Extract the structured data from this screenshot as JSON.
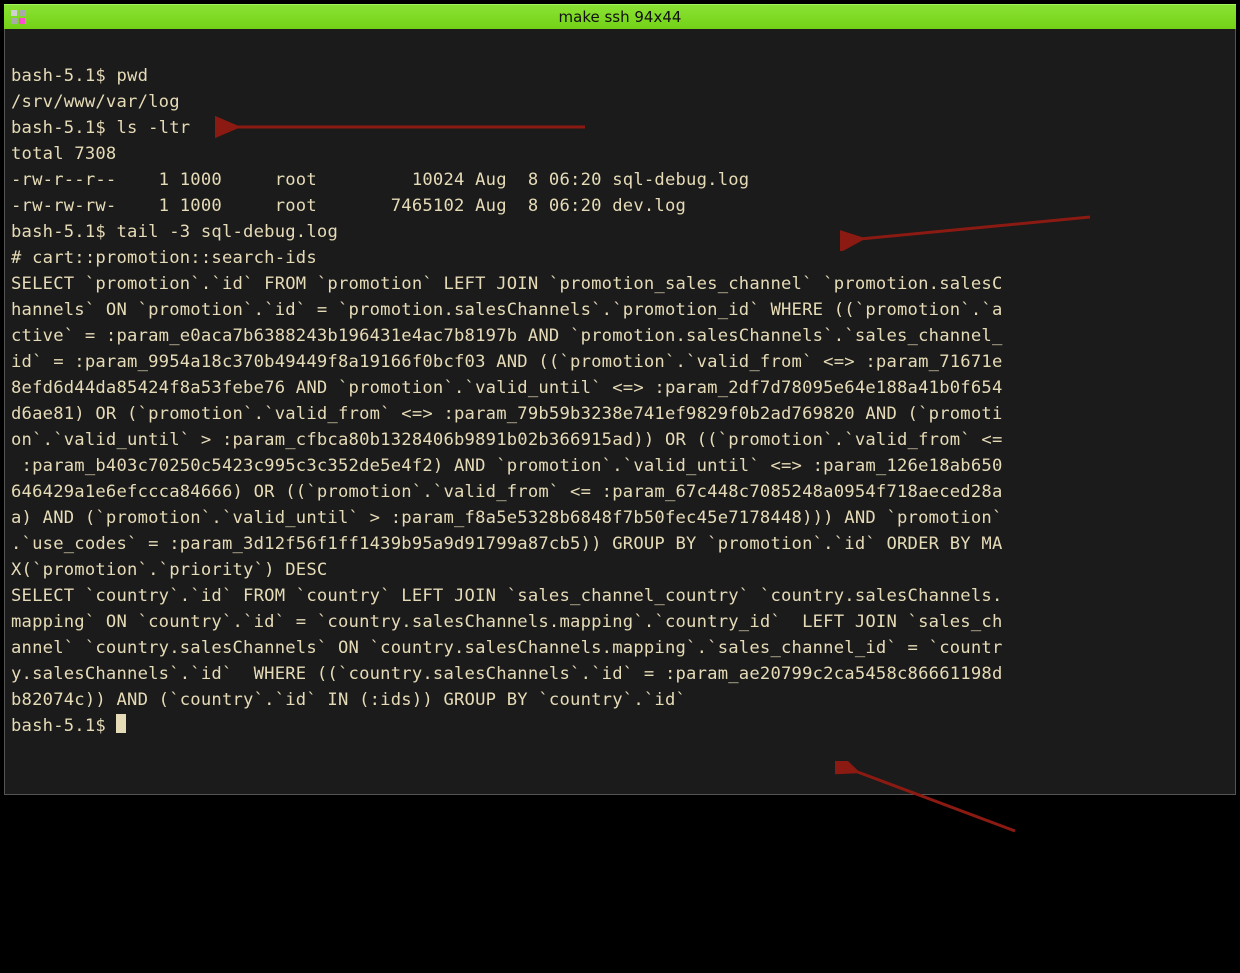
{
  "titlebar": {
    "title": "make ssh 94x44"
  },
  "terminal": {
    "prompt": "bash-5.1$ ",
    "lines": {
      "l01_prompt": "bash-5.1$ ",
      "l01_cmd": "pwd",
      "l02": "/srv/www/var/log",
      "l03_prompt": "bash-5.1$ ",
      "l03_cmd": "ls -ltr",
      "l04": "total 7308",
      "l05": "-rw-r--r--    1 1000     root         10024 Aug  8 06:20 sql-debug.log",
      "l06": "-rw-rw-rw-    1 1000     root       7465102 Aug  8 06:20 dev.log",
      "l07_prompt": "bash-5.1$ ",
      "l07_cmd": "tail -3 sql-debug.log",
      "l08": "# cart::promotion::search-ids",
      "l09": "SELECT `promotion`.`id` FROM `promotion` LEFT JOIN `promotion_sales_channel` `promotion.salesC",
      "l10": "hannels` ON `promotion`.`id` = `promotion.salesChannels`.`promotion_id` WHERE ((`promotion`.`a",
      "l11": "ctive` = :param_e0aca7b6388243b196431e4ac7b8197b AND `promotion.salesChannels`.`sales_channel_",
      "l12": "id` = :param_9954a18c370b49449f8a19166f0bcf03 AND ((`promotion`.`valid_from` <=> :param_71671e",
      "l13": "8efd6d44da85424f8a53febe76 AND `promotion`.`valid_until` <=> :param_2df7d78095e64e188a41b0f654",
      "l14": "d6ae81) OR (`promotion`.`valid_from` <=> :param_79b59b3238e741ef9829f0b2ad769820 AND (`promoti",
      "l15": "on`.`valid_until` > :param_cfbca80b1328406b9891b02b366915ad)) OR ((`promotion`.`valid_from` <=",
      "l16": " :param_b403c70250c5423c995c3c352de5e4f2) AND `promotion`.`valid_until` <=> :param_126e18ab650",
      "l17": "646429a1e6efccca84666) OR ((`promotion`.`valid_from` <= :param_67c448c7085248a0954f718aeced28a",
      "l18": "a) AND (`promotion`.`valid_until` > :param_f8a5e5328b6848f7b50fec45e7178448))) AND `promotion`",
      "l19": ".`use_codes` = :param_3d12f56f1ff1439b95a9d91799a87cb5)) GROUP BY `promotion`.`id` ORDER BY MA",
      "l20": "X(`promotion`.`priority`) DESC",
      "l21": "SELECT `country`.`id` FROM `country` LEFT JOIN `sales_channel_country` `country.salesChannels.",
      "l22": "mapping` ON `country`.`id` = `country.salesChannels.mapping`.`country_id`  LEFT JOIN `sales_ch",
      "l23": "annel` `country.salesChannels` ON `country.salesChannels.mapping`.`sales_channel_id` = `countr",
      "l24": "y.salesChannels`.`id`  WHERE ((`country.salesChannels`.`id` = :param_ae20799c2ca5458c86661198d",
      "l25": "b82074c)) AND (`country`.`id` IN (:ids)) GROUP BY `country`.`id`",
      "l26_prompt": "bash-5.1$ "
    }
  },
  "annotations": {
    "arrow_color": "#8a1a12"
  }
}
